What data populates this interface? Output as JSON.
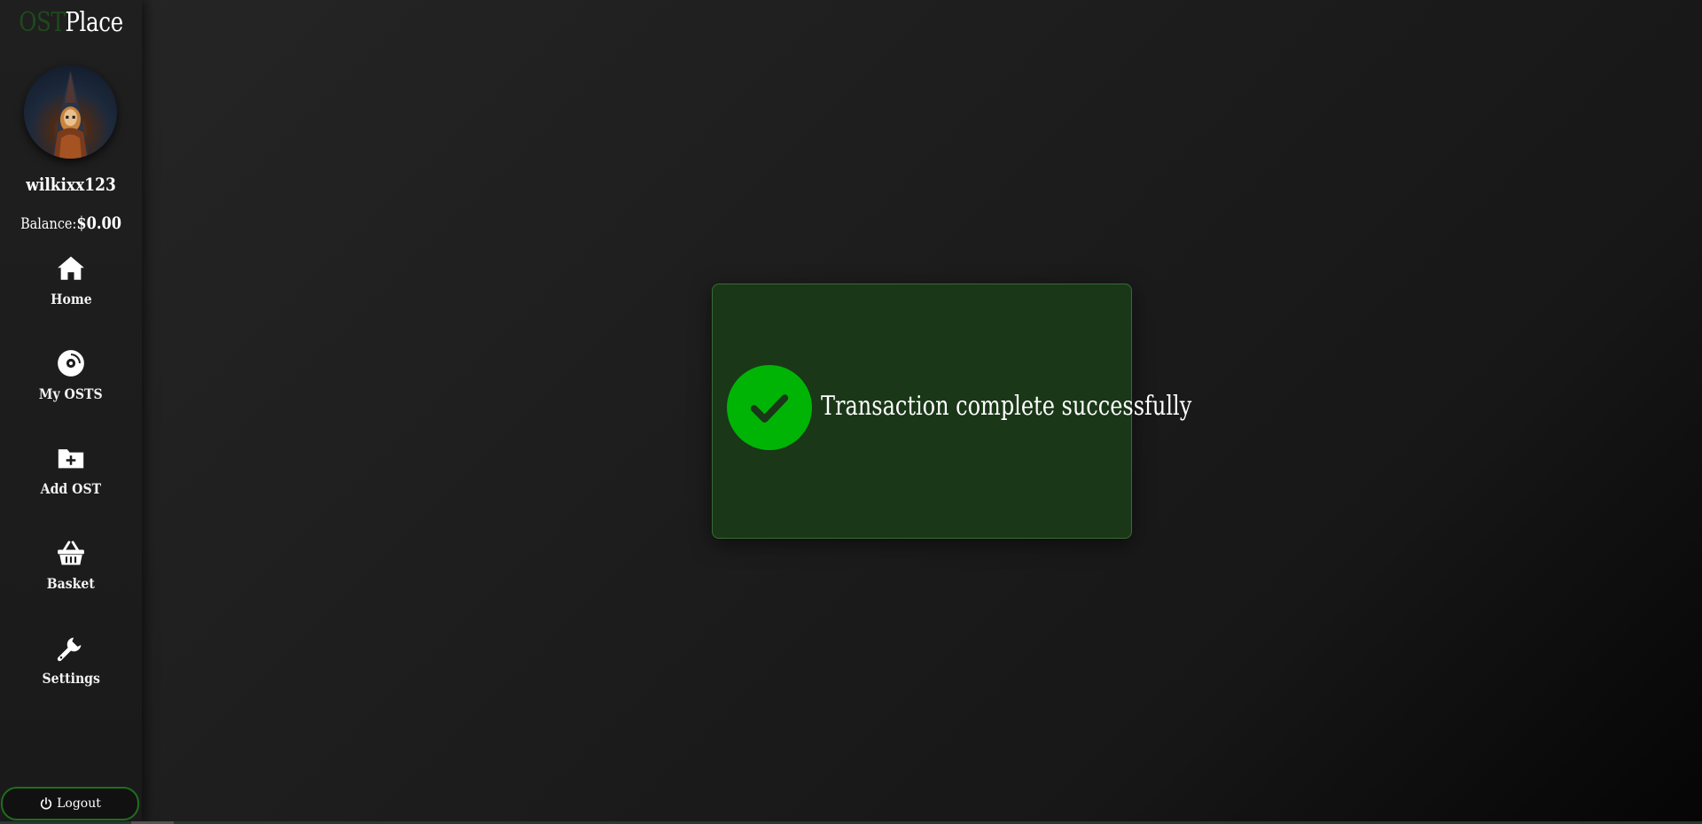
{
  "app": {
    "logo_part1": "OST",
    "logo_part2": "Place"
  },
  "profile": {
    "username": "wilkixx123",
    "balance_label": "Balance:",
    "balance_value": "$0.00"
  },
  "nav": {
    "items": [
      {
        "label": "Home",
        "icon": "home-icon"
      },
      {
        "label": "My OSTS",
        "icon": "disc-icon"
      },
      {
        "label": "Add OST",
        "icon": "folder-plus-icon"
      },
      {
        "label": "Basket",
        "icon": "basket-icon"
      },
      {
        "label": "Settings",
        "icon": "wrench-icon"
      }
    ]
  },
  "logout": {
    "label": "Logout",
    "icon": "power-icon"
  },
  "modal": {
    "message": "Transaction complete successfully",
    "icon": "check-icon"
  },
  "colors": {
    "accent_green": "#00b406",
    "modal_bg": "#1a3718",
    "logo_dark_green": "#1e4a1c",
    "logout_border": "#1f6e1c"
  }
}
